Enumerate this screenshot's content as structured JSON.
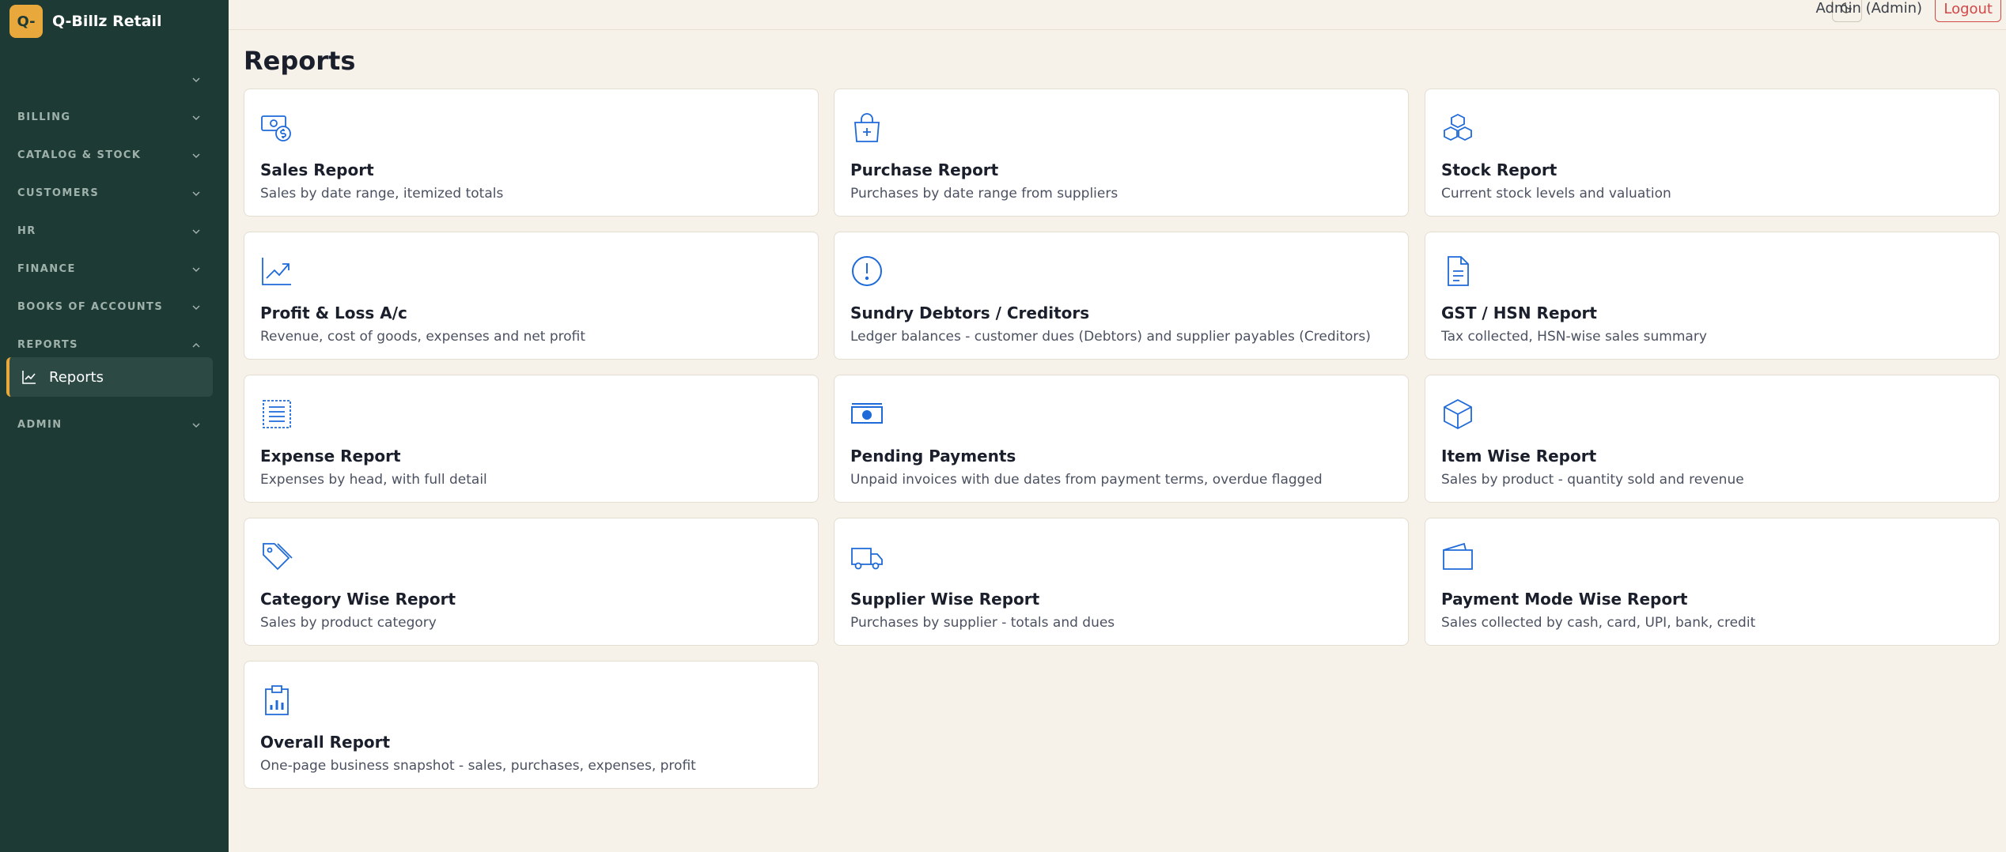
{
  "app": {
    "logo_text": "Q-",
    "name": "Q-Billz Retail"
  },
  "sidebar": {
    "sections": [
      {
        "label": ""
      },
      {
        "label": "BILLING"
      },
      {
        "label": "CATALOG & STOCK"
      },
      {
        "label": "CUSTOMERS"
      },
      {
        "label": "HR"
      },
      {
        "label": "FINANCE"
      },
      {
        "label": "BOOKS OF ACCOUNTS"
      },
      {
        "label": "REPORTS"
      },
      {
        "label": "ADMIN"
      }
    ],
    "active_item": {
      "label": "Reports",
      "icon": "chart-line-icon"
    }
  },
  "topbar": {
    "theme_icon": "moon-icon",
    "user": "Admin (Admin)",
    "logout": "Logout"
  },
  "page": {
    "title": "Reports"
  },
  "cards": [
    {
      "title": "Sales Report",
      "desc": "Sales by date range, itemized totals",
      "icon": "cash-coin-icon"
    },
    {
      "title": "Purchase Report",
      "desc": "Purchases by date range from suppliers",
      "icon": "shopping-bag-icon"
    },
    {
      "title": "Stock Report",
      "desc": "Current stock levels and valuation",
      "icon": "cubes-icon"
    },
    {
      "title": "Profit & Loss A/c",
      "desc": "Revenue, cost of goods, expenses and net profit",
      "icon": "trend-up-icon"
    },
    {
      "title": "Sundry Debtors / Creditors",
      "desc": "Ledger balances - customer dues (Debtors) and supplier payables (Creditors)",
      "icon": "alert-circle-icon"
    },
    {
      "title": "GST / HSN Report",
      "desc": "Tax collected, HSN-wise sales summary",
      "icon": "document-icon"
    },
    {
      "title": "Expense Report",
      "desc": "Expenses by head, with full detail",
      "icon": "receipt-icon"
    },
    {
      "title": "Pending Payments",
      "desc": "Unpaid invoices with due dates from payment terms, overdue flagged",
      "icon": "banknote-icon"
    },
    {
      "title": "Item Wise Report",
      "desc": "Sales by product - quantity sold and revenue",
      "icon": "box-icon"
    },
    {
      "title": "Category Wise Report",
      "desc": "Sales by product category",
      "icon": "tags-icon"
    },
    {
      "title": "Supplier Wise Report",
      "desc": "Purchases by supplier - totals and dues",
      "icon": "truck-icon"
    },
    {
      "title": "Payment Mode Wise Report",
      "desc": "Sales collected by cash, card, UPI, bank, credit",
      "icon": "wallet-icon"
    },
    {
      "title": "Overall Report",
      "desc": "One-page business snapshot - sales, purchases, expenses, profit",
      "icon": "clipboard-chart-icon"
    }
  ]
}
